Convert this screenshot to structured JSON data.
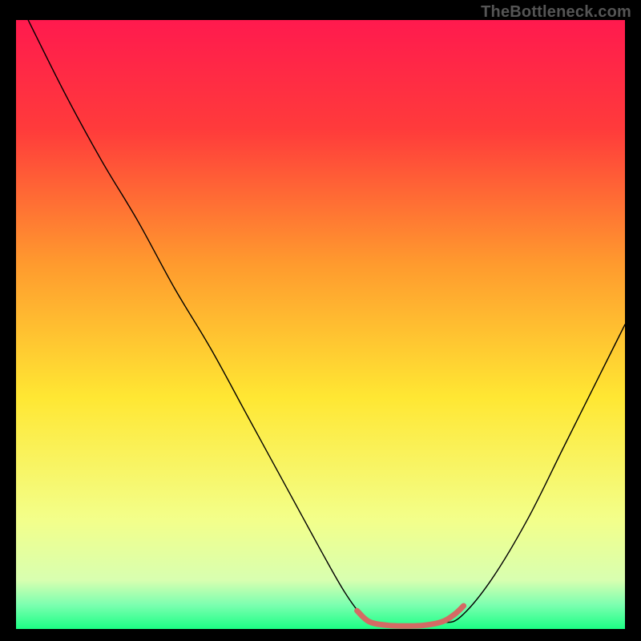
{
  "watermark": "TheBottleneck.com",
  "chart_data": {
    "type": "line",
    "title": "",
    "xlabel": "",
    "ylabel": "",
    "xlim": [
      0,
      100
    ],
    "ylim": [
      0,
      100
    ],
    "background_gradient": {
      "stops": [
        {
          "offset": 0,
          "color": "#ff1a4e"
        },
        {
          "offset": 0.18,
          "color": "#ff3b3b"
        },
        {
          "offset": 0.4,
          "color": "#ff9a2e"
        },
        {
          "offset": 0.62,
          "color": "#ffe733"
        },
        {
          "offset": 0.82,
          "color": "#f3ff8a"
        },
        {
          "offset": 0.92,
          "color": "#d8ffb0"
        },
        {
          "offset": 0.96,
          "color": "#7dffb0"
        },
        {
          "offset": 1.0,
          "color": "#1cff85"
        }
      ]
    },
    "series": [
      {
        "name": "bottleneck-curve",
        "color": "#000000",
        "width": 1.4,
        "points": [
          {
            "x": 2,
            "y": 100
          },
          {
            "x": 8,
            "y": 88
          },
          {
            "x": 14,
            "y": 77
          },
          {
            "x": 20,
            "y": 67
          },
          {
            "x": 26,
            "y": 56
          },
          {
            "x": 32,
            "y": 46
          },
          {
            "x": 38,
            "y": 35
          },
          {
            "x": 44,
            "y": 24
          },
          {
            "x": 50,
            "y": 13
          },
          {
            "x": 54,
            "y": 6
          },
          {
            "x": 57,
            "y": 2
          },
          {
            "x": 59,
            "y": 1
          },
          {
            "x": 62,
            "y": 0.5
          },
          {
            "x": 66,
            "y": 0.5
          },
          {
            "x": 70,
            "y": 1
          },
          {
            "x": 73,
            "y": 2
          },
          {
            "x": 78,
            "y": 8
          },
          {
            "x": 84,
            "y": 18
          },
          {
            "x": 90,
            "y": 30
          },
          {
            "x": 96,
            "y": 42
          },
          {
            "x": 100,
            "y": 50
          }
        ]
      },
      {
        "name": "optimal-zone-marker",
        "color": "#d46a64",
        "width": 7,
        "points": [
          {
            "x": 56,
            "y": 3
          },
          {
            "x": 58,
            "y": 1.2
          },
          {
            "x": 61,
            "y": 0.6
          },
          {
            "x": 64,
            "y": 0.5
          },
          {
            "x": 67,
            "y": 0.6
          },
          {
            "x": 70,
            "y": 1.2
          },
          {
            "x": 72,
            "y": 2.4
          },
          {
            "x": 73.5,
            "y": 3.8
          }
        ]
      }
    ]
  }
}
